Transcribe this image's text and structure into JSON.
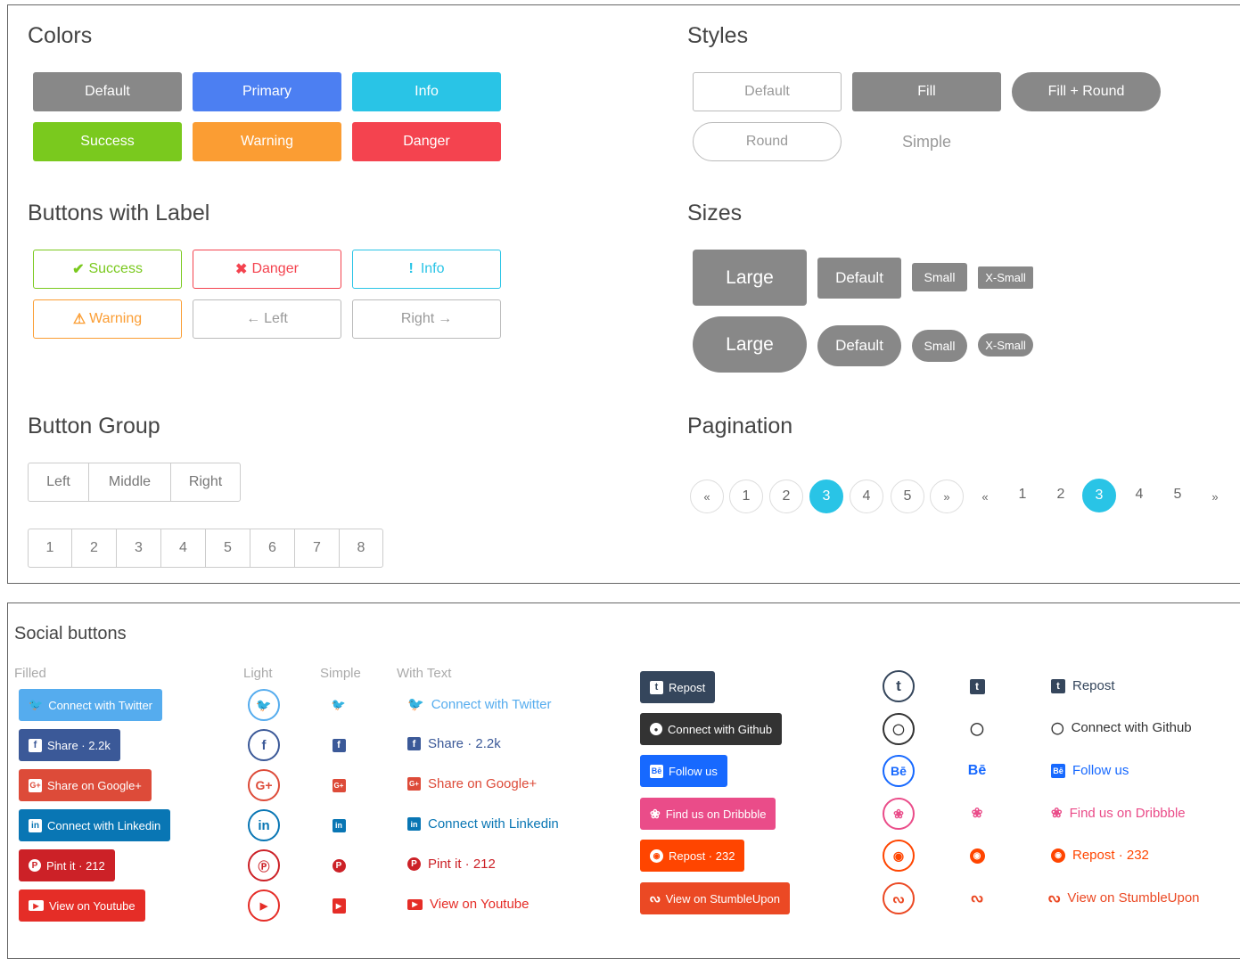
{
  "colors_section": {
    "title": "Colors",
    "buttons": [
      {
        "label": "Default",
        "color": "#888888"
      },
      {
        "label": "Primary",
        "color": "#4c7ff2"
      },
      {
        "label": "Info",
        "color": "#29c4e6"
      },
      {
        "label": "Success",
        "color": "#7ac91e"
      },
      {
        "label": "Warning",
        "color": "#fb9d33"
      },
      {
        "label": "Danger",
        "color": "#f4434f"
      }
    ]
  },
  "styles_section": {
    "title": "Styles",
    "default_label": "Default",
    "fill_label": "Fill",
    "fill_round_label": "Fill + Round",
    "round_label": "Round",
    "simple_label": "Simple"
  },
  "labels_section": {
    "title": "Buttons with Label",
    "success": "Success",
    "danger": "Danger",
    "info": "Info",
    "warning": "Warning",
    "left": "Left",
    "right": "Right"
  },
  "sizes_section": {
    "title": "Sizes",
    "large": "Large",
    "default": "Default",
    "small": "Small",
    "xsmall": "X-Small"
  },
  "group_section": {
    "title": "Button Group",
    "group1": [
      "Left",
      "Middle",
      "Right"
    ],
    "group2": [
      "1",
      "2",
      "3",
      "4",
      "5",
      "6",
      "7",
      "8"
    ]
  },
  "pagination_section": {
    "title": "Pagination",
    "prev": "«",
    "next": "»",
    "pages": [
      "1",
      "2",
      "3",
      "4",
      "5"
    ],
    "active": "3"
  },
  "social_section": {
    "title": "Social buttons",
    "col_filled": "Filled",
    "col_light": "Light",
    "col_simple": "Simple",
    "col_with_text": "With Text",
    "left_networks": [
      {
        "icon": "twitter-icon",
        "glyph": "➤",
        "label": "Connect with Twitter",
        "color": "#55acee"
      },
      {
        "icon": "facebook-icon",
        "glyph": "f",
        "label": "Share · 2.2k",
        "color": "#3b5998"
      },
      {
        "icon": "google-plus-icon",
        "glyph": "G+",
        "label": "Share on Google+",
        "color": "#dd4b39"
      },
      {
        "icon": "linkedin-icon",
        "glyph": "in",
        "label": "Connect with Linkedin",
        "color": "#0976b4"
      },
      {
        "icon": "pinterest-icon",
        "glyph": "P",
        "label": "Pint it · 212",
        "color": "#cc2127"
      },
      {
        "icon": "youtube-icon",
        "glyph": "▶",
        "label": "View on Youtube",
        "color": "#e52d27"
      }
    ],
    "right_networks": [
      {
        "icon": "tumblr-icon",
        "glyph": "t",
        "label": "Repost",
        "color": "#35465c"
      },
      {
        "icon": "github-icon",
        "glyph": "●",
        "label": "Connect with Github",
        "color": "#333333"
      },
      {
        "icon": "behance-icon",
        "glyph": "Bē",
        "label": "Follow us",
        "color": "#1769ff"
      },
      {
        "icon": "dribbble-icon",
        "glyph": "❀",
        "label": "Find us on Dribbble",
        "color": "#ea4c89"
      },
      {
        "icon": "reddit-icon",
        "glyph": "◉",
        "label": "Repost · 232",
        "color": "#ff4500"
      },
      {
        "icon": "stumbleupon-icon",
        "glyph": "Su",
        "label": "View on StumbleUpon",
        "color": "#eb4924"
      }
    ]
  }
}
